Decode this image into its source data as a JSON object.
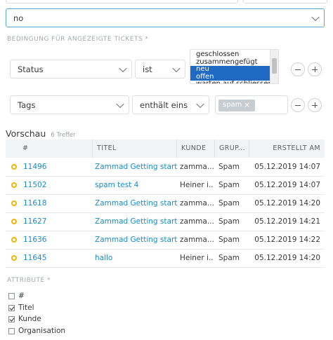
{
  "top_select": {
    "value": "no"
  },
  "conditions": {
    "heading": "BEDINGUNG FÜR ANGEZEIGTE TICKETS *",
    "row1": {
      "attribute": "Status",
      "operator": "ist",
      "options": [
        {
          "label": "geschlossen",
          "selected": false
        },
        {
          "label": "zusammengefügt",
          "selected": false
        },
        {
          "label": "neu",
          "selected": true
        },
        {
          "label": "offen",
          "selected": true
        },
        {
          "label": "warten auf schliessen",
          "selected": false
        }
      ]
    },
    "row2": {
      "attribute": "Tags",
      "operator": "enthält eins",
      "token": "spam",
      "token_remove": "×"
    }
  },
  "preview": {
    "title": "Vorschau",
    "count": "6 Treffer",
    "columns": [
      "#",
      "TITEL",
      "KUNDE",
      "GRUP...",
      "ERSTELLT AM"
    ],
    "rows": [
      {
        "number": "11496",
        "title": "Zammad Getting starte...",
        "customer": "zamma...",
        "group": "Spam",
        "created": "05.12.2019 14:07"
      },
      {
        "number": "11502",
        "title": "spam test 4",
        "customer": "Heiner i...",
        "group": "Spam",
        "created": "05.12.2019 14:07"
      },
      {
        "number": "11618",
        "title": "Zammad Getting starte...",
        "customer": "zamma...",
        "group": "Spam",
        "created": "05.12.2019 14:20"
      },
      {
        "number": "11627",
        "title": "Zammad Getting starte...",
        "customer": "zamma...",
        "group": "Spam",
        "created": "05.12.2019 14:21"
      },
      {
        "number": "11636",
        "title": "Zammad Getting starte...",
        "customer": "zamma...",
        "group": "Spam",
        "created": "05.12.2019 14:22"
      },
      {
        "number": "11645",
        "title": "hallo",
        "customer": "Heiner i...",
        "group": "Spam",
        "created": "05.12.2019 14:20"
      }
    ]
  },
  "attributes": {
    "heading": "ATTRIBUTE *",
    "items": [
      {
        "label": "#",
        "checked": false
      },
      {
        "label": "Titel",
        "checked": true
      },
      {
        "label": "Kunde",
        "checked": true
      },
      {
        "label": "Organisation",
        "checked": false
      }
    ]
  },
  "colors": {
    "accent": "#1a8bc7",
    "status_open": "#f4b400",
    "selected_option": "#1f6bc4"
  }
}
